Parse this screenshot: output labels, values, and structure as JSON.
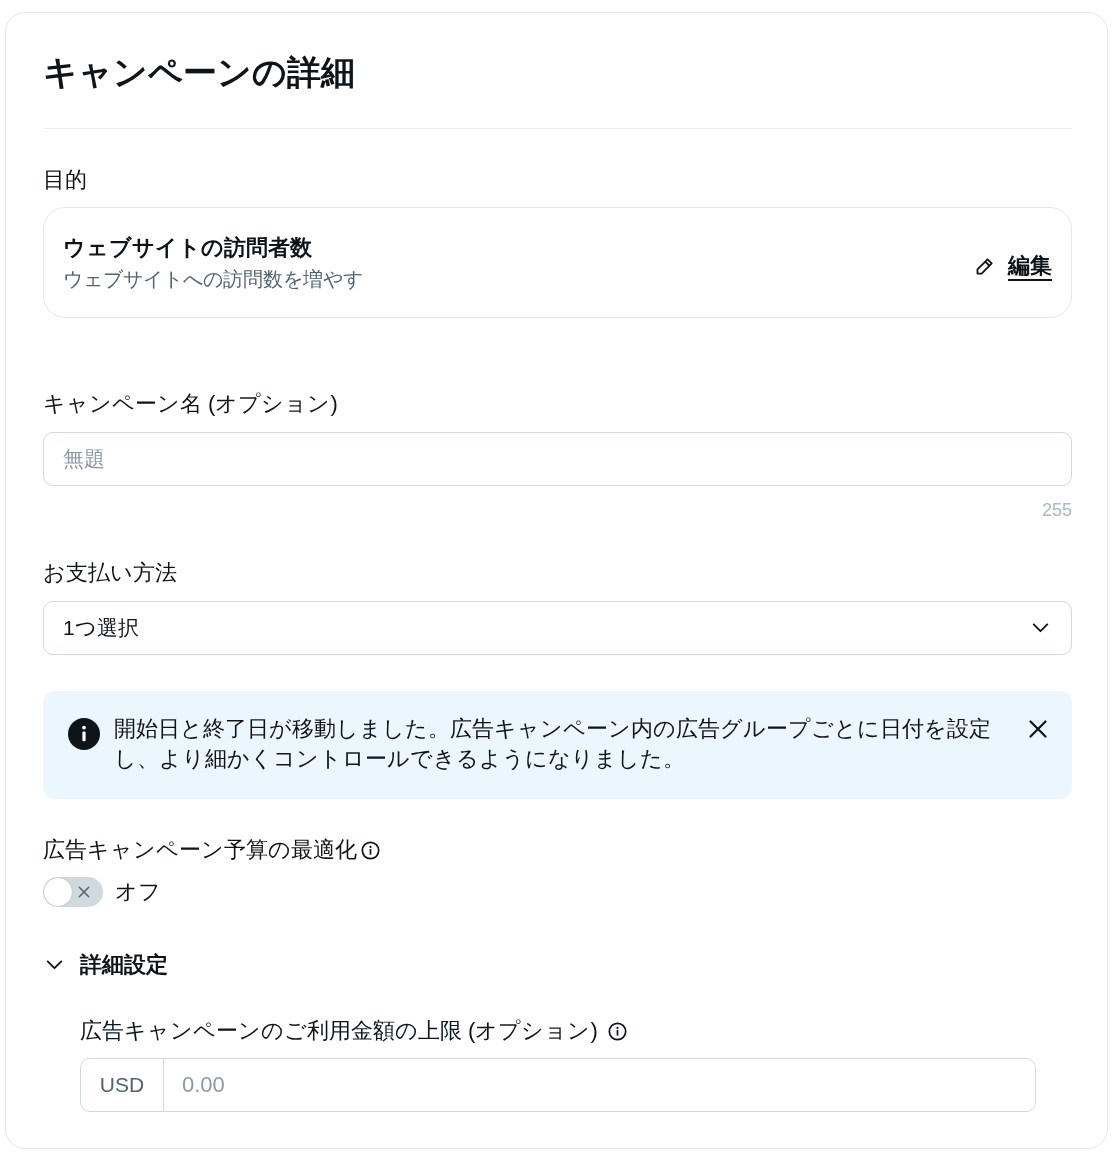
{
  "title": "キャンペーンの詳細",
  "objective": {
    "label": "目的",
    "name": "ウェブサイトの訪問者数",
    "description": "ウェブサイトへの訪問数を増やす",
    "edit_link": "編集"
  },
  "campaign_name": {
    "label": "キャンペーン名 (オプション)",
    "placeholder": "無題",
    "counter": "255"
  },
  "payment_method": {
    "label": "お支払い方法",
    "value": "1つ選択"
  },
  "notice": {
    "text": "開始日と終了日が移動しました。広告キャンペーン内の広告グループごとに日付を設定し、より細かくコントロールできるようになりました。"
  },
  "budget_optimization": {
    "label": "広告キャンペーン予算の最適化",
    "on": false,
    "state_label": "オフ"
  },
  "advanced_settings": {
    "label": "詳細設定",
    "expanded": true,
    "fields": [
      {
        "label": "広告キャンペーンのご利用金額の上限 (オプション)",
        "prefix": "USD",
        "placeholder": "0.00"
      }
    ]
  }
}
